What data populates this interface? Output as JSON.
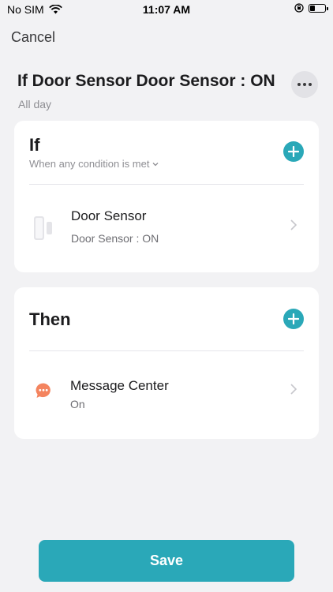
{
  "status_bar": {
    "carrier": "No SIM",
    "time": "11:07 AM",
    "battery_level": 0.35
  },
  "nav": {
    "cancel_label": "Cancel",
    "more_icon": "more-horizontal-icon"
  },
  "scene": {
    "title": "If Door Sensor Door Sensor : ON",
    "schedule": "All day"
  },
  "if_section": {
    "heading": "If",
    "condition_mode": "When any condition is met",
    "items": [
      {
        "icon": "door-sensor-icon",
        "title": "Door Sensor",
        "subtitle": "Door Sensor : ON"
      }
    ]
  },
  "then_section": {
    "heading": "Then",
    "items": [
      {
        "icon": "message-center-icon",
        "title": "Message Center",
        "subtitle": "On"
      }
    ]
  },
  "actions": {
    "save_label": "Save"
  },
  "colors": {
    "accent": "#2aa8b8",
    "background": "#f2f2f4",
    "message_icon": "#f4845f"
  }
}
